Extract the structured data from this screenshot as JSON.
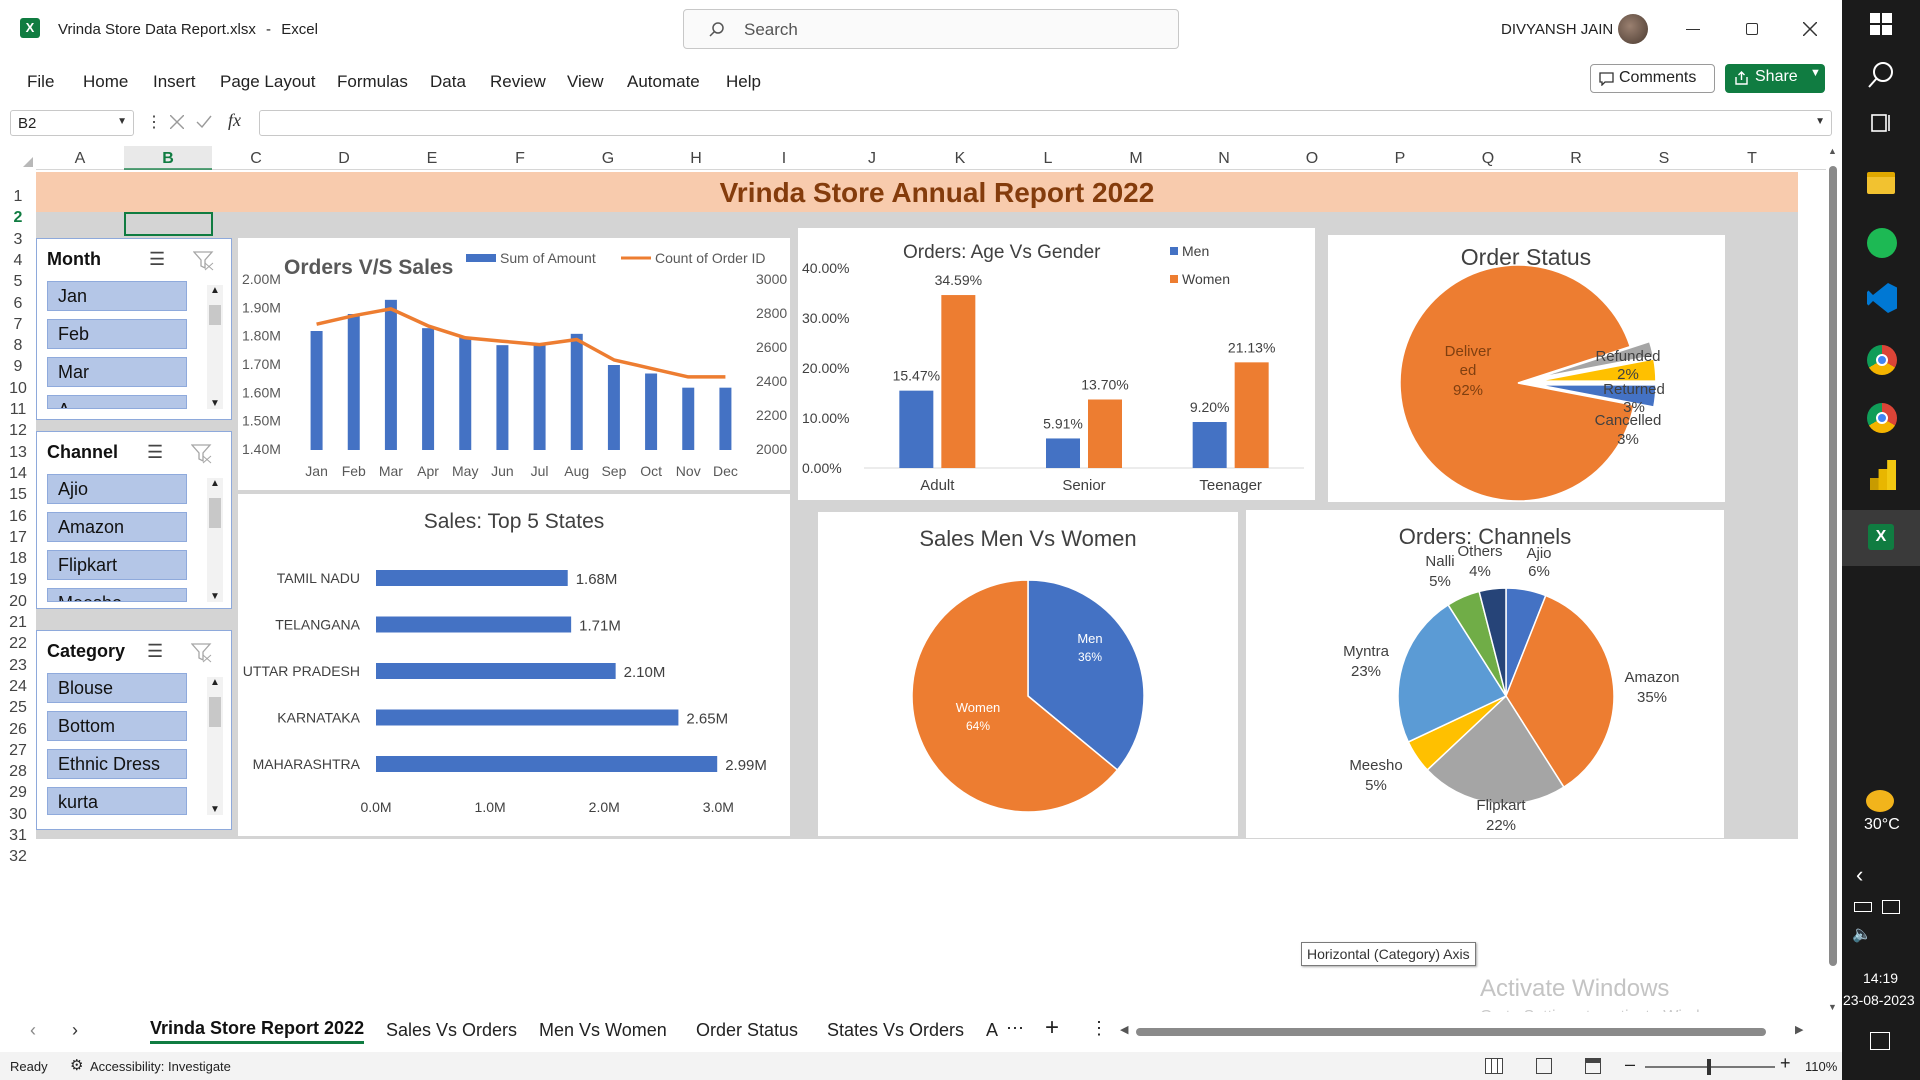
{
  "window": {
    "filename": "Vrinda Store Data Report.xlsx",
    "sep": "-",
    "app": "Excel",
    "search_placeholder": "Search",
    "user": "DIVYANSH JAIN"
  },
  "menu": [
    "File",
    "Home",
    "Insert",
    "Page Layout",
    "Formulas",
    "Data",
    "Review",
    "View",
    "Automate",
    "Help"
  ],
  "toolbar": {
    "comments_label": "Comments",
    "share_label": "Share"
  },
  "formula": {
    "name_box": "B2",
    "fx": "fx",
    "value": ""
  },
  "columns": [
    "A",
    "B",
    "C",
    "D",
    "E",
    "F",
    "G",
    "H",
    "I",
    "J",
    "K",
    "L",
    "M",
    "N",
    "O",
    "P",
    "Q",
    "R",
    "S",
    "T"
  ],
  "rows": [
    "1",
    "2",
    "3",
    "4",
    "5",
    "6",
    "7",
    "8",
    "9",
    "10",
    "11",
    "12",
    "13",
    "14",
    "15",
    "16",
    "17",
    "18",
    "19",
    "20",
    "21",
    "22",
    "23",
    "24",
    "25",
    "26",
    "27",
    "28",
    "29",
    "30",
    "31",
    "32"
  ],
  "report_title": "Vrinda Store Annual Report 2022",
  "slicers": {
    "month": {
      "title": "Month",
      "items": [
        "Jan",
        "Feb",
        "Mar",
        "A"
      ]
    },
    "channel": {
      "title": "Channel",
      "items": [
        "Ajio",
        "Amazon",
        "Flipkart",
        "Meesho"
      ]
    },
    "category": {
      "title": "Category",
      "items": [
        "Blouse",
        "Bottom",
        "Ethnic Dress",
        "kurta"
      ]
    }
  },
  "tooltip": "Horizontal (Category) Axis",
  "activate": {
    "line1": "Activate Windows",
    "line2": "Go to Settings to activate Windows."
  },
  "sheet_tabs": [
    "Vrinda Store Report 2022",
    "Sales Vs Orders",
    "Men Vs Women",
    "Order Status",
    "States Vs Orders",
    "A"
  ],
  "status": {
    "ready": "Ready",
    "accessibility": "Accessibility: Investigate",
    "zoom": "110%"
  },
  "taskbar": {
    "temp": "30°C",
    "time": "14:19",
    "date": "23-08-2023"
  },
  "colors": {
    "blue": "#4472c4",
    "orange": "#ed7d31",
    "gray": "#a5a5a5",
    "yellow": "#ffc000",
    "lightblue": "#5b9bd5",
    "green": "#70ad47",
    "navy": "#264478",
    "banner": "#f8cbad",
    "excel_green": "#107c41"
  },
  "chart_data": [
    {
      "id": "orders_vs_sales",
      "type": "bar",
      "title": "Orders V/S Sales",
      "categories": [
        "Jan",
        "Feb",
        "Mar",
        "Apr",
        "May",
        "Jun",
        "Jul",
        "Aug",
        "Sep",
        "Oct",
        "Nov",
        "Dec"
      ],
      "series": [
        {
          "name": "Sum of Amount",
          "type": "bar",
          "axis": "left",
          "values": [
            1820000,
            1880000,
            1930000,
            1830000,
            1800000,
            1770000,
            1770000,
            1810000,
            1700000,
            1670000,
            1620000,
            1620000
          ]
        },
        {
          "name": "Count of Order ID",
          "type": "line",
          "axis": "right",
          "values": [
            2740,
            2790,
            2830,
            2730,
            2660,
            2640,
            2620,
            2650,
            2530,
            2480,
            2430,
            2430
          ]
        }
      ],
      "y_ticks": [
        "2.00M",
        "1.90M",
        "1.80M",
        "1.70M",
        "1.60M",
        "1.50M",
        "1.40M"
      ],
      "y2_ticks": [
        "3000",
        "2800",
        "2600",
        "2400",
        "2200",
        "2000"
      ],
      "ylim": [
        1400000,
        2000000
      ],
      "y2lim": [
        2000,
        3000
      ],
      "legend": "top"
    },
    {
      "id": "age_vs_gender",
      "type": "bar",
      "title": "Orders: Age Vs Gender",
      "categories": [
        "Adult",
        "Senior",
        "Teenager"
      ],
      "series": [
        {
          "name": "Men",
          "values": [
            15.47,
            5.91,
            9.2
          ],
          "labels": [
            "15.47%",
            "5.91%",
            "9.20%"
          ]
        },
        {
          "name": "Women",
          "values": [
            34.59,
            13.7,
            21.13
          ],
          "labels": [
            "34.59%",
            "13.70%",
            "21.13%"
          ]
        }
      ],
      "y_ticks": [
        "40.00%",
        "30.00%",
        "20.00%",
        "10.00%",
        "0.00%"
      ],
      "ylim": [
        0,
        40
      ],
      "legend": "top-right"
    },
    {
      "id": "order_status",
      "type": "pie",
      "title": "Order Status",
      "slices": [
        {
          "name": "Delivered",
          "value": 92,
          "label": "92%"
        },
        {
          "name": "Refunded",
          "value": 2,
          "label": "2%"
        },
        {
          "name": "Returned",
          "value": 3,
          "label": "3%"
        },
        {
          "name": "Cancelled",
          "value": 3,
          "label": "3%"
        }
      ]
    },
    {
      "id": "top5_states",
      "type": "bar",
      "orientation": "horizontal",
      "title": "Sales: Top 5 States",
      "categories": [
        "TAMIL NADU",
        "TELANGANA",
        "UTTAR PRADESH",
        "KARNATAKA",
        "MAHARASHTRA"
      ],
      "values": [
        1.68,
        1.71,
        2.1,
        2.65,
        2.99
      ],
      "labels": [
        "1.68M",
        "1.71M",
        "2.10M",
        "2.65M",
        "2.99M"
      ],
      "x_ticks": [
        "0.0M",
        "1.0M",
        "2.0M",
        "3.0M"
      ],
      "xlim": [
        0,
        3.4
      ]
    },
    {
      "id": "men_vs_women",
      "type": "pie",
      "title": "Sales Men Vs Women",
      "slices": [
        {
          "name": "Men",
          "value": 36,
          "label": "36%"
        },
        {
          "name": "Women",
          "value": 64,
          "label": "64%"
        }
      ]
    },
    {
      "id": "channels",
      "type": "pie",
      "title": "Orders: Channels",
      "slices": [
        {
          "name": "Ajio",
          "value": 6,
          "label": "6%"
        },
        {
          "name": "Amazon",
          "value": 35,
          "label": "35%"
        },
        {
          "name": "Flipkart",
          "value": 22,
          "label": "22%"
        },
        {
          "name": "Meesho",
          "value": 5,
          "label": "5%"
        },
        {
          "name": "Myntra",
          "value": 23,
          "label": "23%"
        },
        {
          "name": "Nalli",
          "value": 5,
          "label": "5%"
        },
        {
          "name": "Others",
          "value": 4,
          "label": "4%"
        }
      ]
    }
  ]
}
